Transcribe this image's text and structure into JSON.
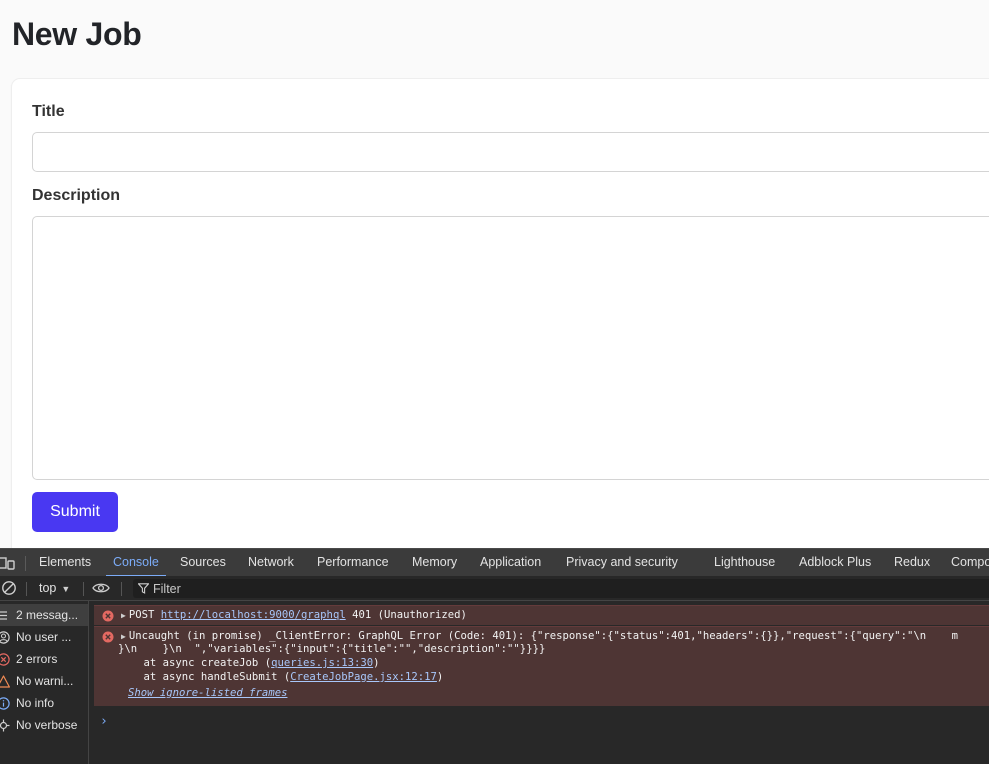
{
  "page": {
    "title": "New Job",
    "form": {
      "title_label": "Title",
      "title_value": "",
      "description_label": "Description",
      "description_value": "",
      "submit_label": "Submit",
      "accent_color": "#4938f2"
    }
  },
  "devtools": {
    "tabs": [
      {
        "label": "Elements"
      },
      {
        "label": "Console",
        "active": true
      },
      {
        "label": "Sources"
      },
      {
        "label": "Network"
      },
      {
        "label": "Performance"
      },
      {
        "label": "Memory"
      },
      {
        "label": "Application"
      },
      {
        "label": "Privacy and security"
      },
      {
        "label": "Lighthouse"
      },
      {
        "label": "Adblock Plus"
      },
      {
        "label": "Redux"
      },
      {
        "label": "Compo"
      }
    ],
    "toolbar": {
      "context": "top",
      "filter_placeholder": "Filter"
    },
    "sidebar": [
      {
        "label": "2 messag...",
        "icon": "list-icon",
        "selected": true
      },
      {
        "label": "No user ...",
        "icon": "user-icon"
      },
      {
        "label": "2 errors",
        "icon": "error-icon"
      },
      {
        "label": "No warni...",
        "icon": "warning-icon"
      },
      {
        "label": "No info",
        "icon": "info-icon"
      },
      {
        "label": "No verbose",
        "icon": "verbose-icon"
      }
    ],
    "messages": {
      "m1": {
        "method": "POST",
        "url": "http://localhost:9000/graphql",
        "status": "401 (Unauthorized)"
      },
      "m2": {
        "line1": "Uncaught (in promise) _ClientError: GraphQL Error (Code: 401): {\"response\":{\"status\":401,\"headers\":{}},\"request\":{\"query\":\"\\n    m",
        "line2": "}\\n    }\\n  \",\"variables\":{\"input\":{\"title\":\"\",\"description\":\"\"}}}}",
        "line3_prefix": "    at async createJob (",
        "line3_link": "queries.js:13:30",
        "line4_prefix": "    at async handleSubmit (",
        "line4_link": "CreateJobPage.jsx:12:17",
        "close_paren": ")",
        "show_ignored": "Show ignore-listed frames"
      }
    },
    "prompt_symbol": "›",
    "error_color": "#e46962"
  }
}
